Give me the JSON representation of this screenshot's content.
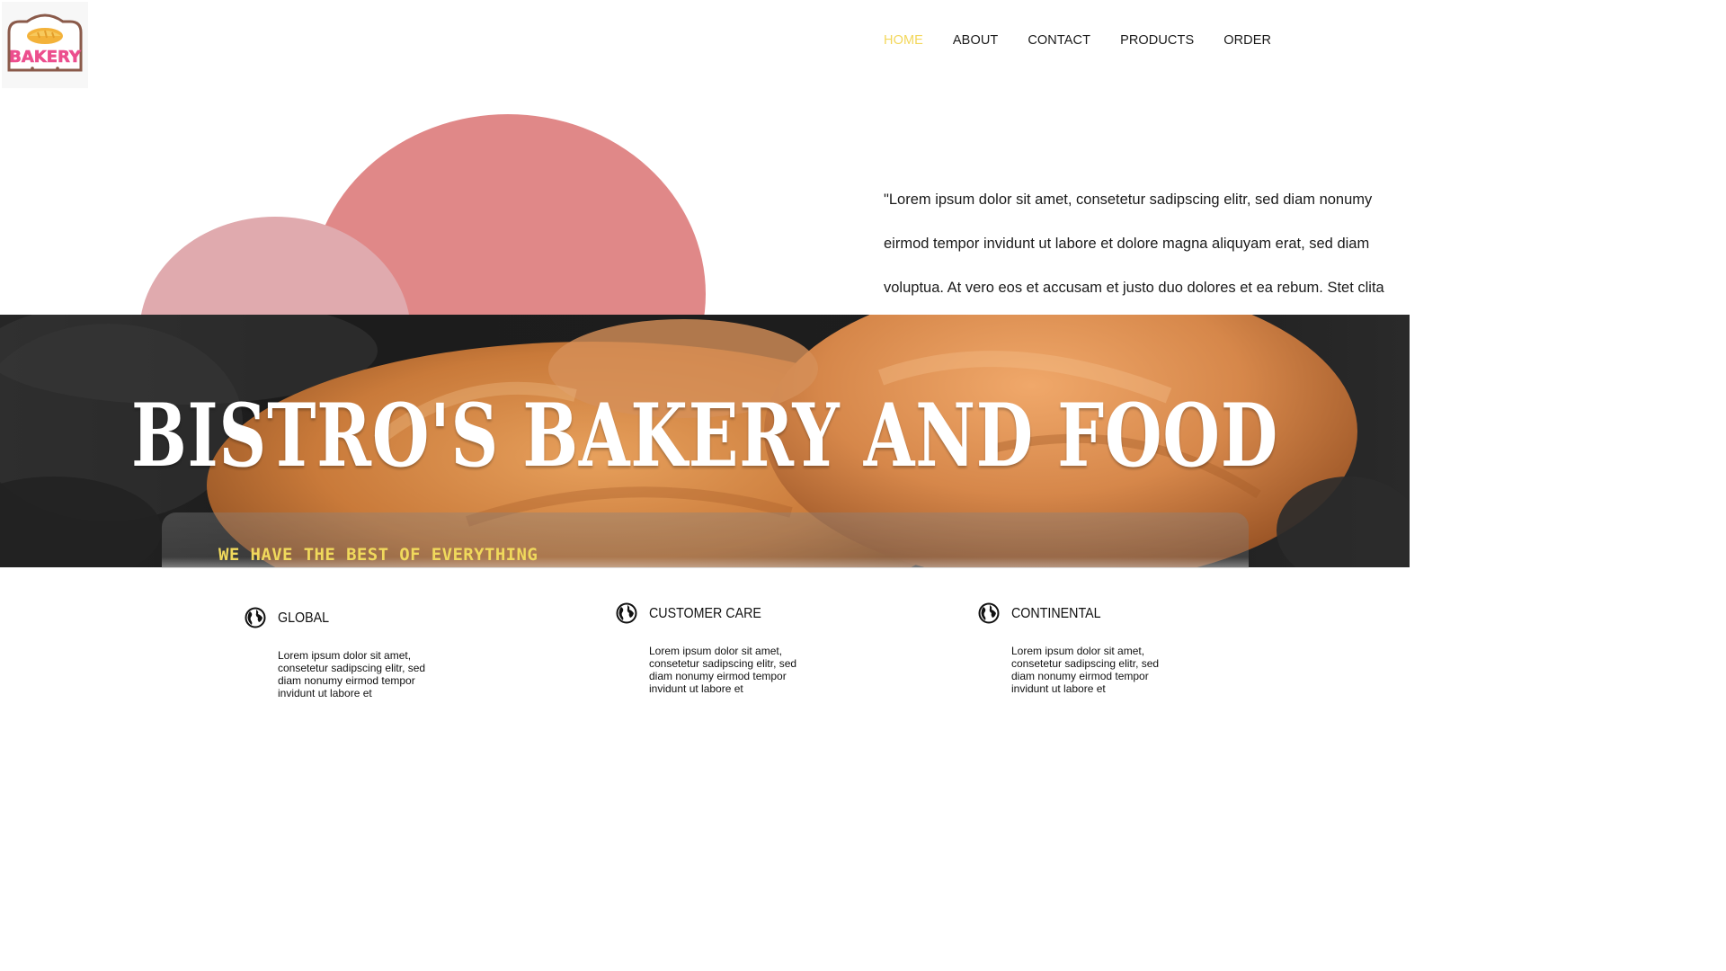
{
  "brand": {
    "logo_text": "BAKERY"
  },
  "nav": {
    "items": [
      {
        "label": "HOME",
        "active": true
      },
      {
        "label": "ABOUT",
        "active": false
      },
      {
        "label": "CONTACT",
        "active": false
      },
      {
        "label": "PRODUCTS",
        "active": false
      },
      {
        "label": "ORDER",
        "active": false
      }
    ],
    "active_color": "#f3d75a"
  },
  "intro": {
    "text": "\"Lorem ipsum dolor sit amet, consetetur sadipscing elitr, sed diam nonumy eirmod tempor invidunt ut labore et dolore magna aliquyam erat, sed diam voluptua. At vero eos et accusam et justo duo dolores et ea rebum. Stet clita"
  },
  "hero": {
    "title": "BISTRO'S BAKERY AND FOOD",
    "tagline": "WE HAVE THE BEST OF EVERYTHING"
  },
  "features": [
    {
      "icon": "globe-icon",
      "title": "GLOBAL",
      "text": "Lorem ipsum dolor sit amet, consetetur sadipscing elitr, sed diam nonumy eirmod tempor invidunt ut labore et"
    },
    {
      "icon": "globe-icon",
      "title": "CUSTOMER CARE",
      "text": "Lorem ipsum dolor sit amet, consetetur sadipscing elitr, sed diam nonumy eirmod tempor invidunt ut labore et"
    },
    {
      "icon": "globe-icon",
      "title": "CONTINENTAL",
      "text": "Lorem ipsum dolor sit amet, consetetur sadipscing elitr, sed diam nonumy eirmod tempor invidunt ut labore et"
    }
  ],
  "colors": {
    "blob_large": "#e08888",
    "blob_small": "#e0aaae",
    "tagline": "#f0d95c",
    "logo_pink": "#ec4f8e",
    "logo_frame": "#8a5a4a",
    "logo_bread": "#f3b23a"
  }
}
